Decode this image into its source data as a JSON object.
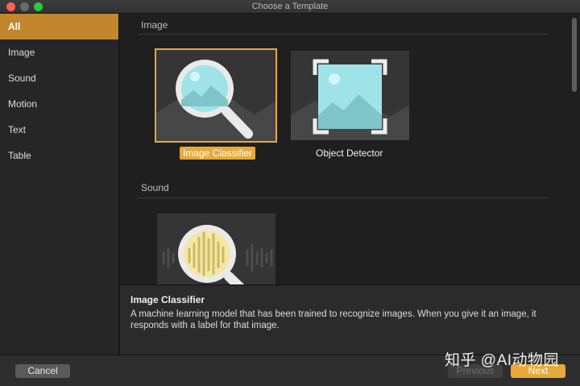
{
  "window": {
    "title": "Choose a Template"
  },
  "sidebar": {
    "items": [
      {
        "label": "All",
        "selected": true
      },
      {
        "label": "Image"
      },
      {
        "label": "Sound"
      },
      {
        "label": "Motion"
      },
      {
        "label": "Text"
      },
      {
        "label": "Table"
      }
    ]
  },
  "sections": [
    {
      "header": "Image",
      "templates": [
        {
          "label": "Image Classifier",
          "icon": "magnifier-image-icon",
          "selected": true
        },
        {
          "label": "Object Detector",
          "icon": "detector-frame-icon"
        }
      ]
    },
    {
      "header": "Sound",
      "templates": [
        {
          "label": "",
          "icon": "magnifier-waveform-icon"
        }
      ]
    }
  ],
  "description": {
    "title": "Image Classifier",
    "text": "A machine learning model that has been trained to recognize images. When you give it an image, it responds with a label for that image."
  },
  "footer": {
    "cancel_label": "Cancel",
    "previous_label": "Previous",
    "next_label": "Next"
  },
  "watermark": {
    "text": "知乎 @AI动物园"
  },
  "colors": {
    "accent": "#e6a93a",
    "sidebar_selected": "#c2872d"
  }
}
